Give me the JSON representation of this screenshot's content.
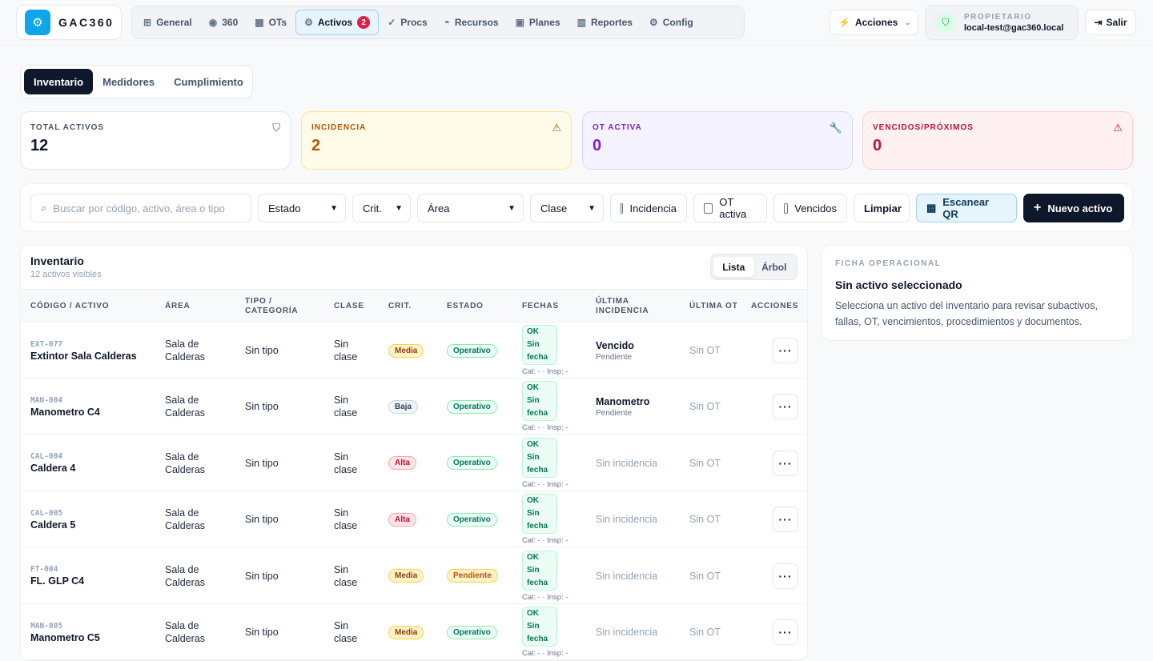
{
  "app": {
    "name": "GAC360"
  },
  "nav": [
    {
      "label": "General",
      "icon": "grid-icon",
      "glyph": "⊞"
    },
    {
      "label": "360",
      "icon": "eye-icon",
      "glyph": "◉"
    },
    {
      "label": "OTs",
      "icon": "table-icon",
      "glyph": "▦"
    },
    {
      "label": "Activos",
      "icon": "assets-icon",
      "glyph": "⚙",
      "badge": "2",
      "active": true
    },
    {
      "label": "Procs",
      "icon": "check-circle-icon",
      "glyph": "✓"
    },
    {
      "label": "Recursos",
      "icon": "helmet-icon",
      "glyph": "◓"
    },
    {
      "label": "Planes",
      "icon": "calendar-icon",
      "glyph": "▣"
    },
    {
      "label": "Reportes",
      "icon": "bar-chart-icon",
      "glyph": "▥"
    },
    {
      "label": "Config",
      "icon": "gear-icon",
      "glyph": "⚙"
    }
  ],
  "header": {
    "acciones_label": "Acciones",
    "user_role": "PROPIETARIO",
    "user_email": "local-test@gac360.local",
    "salir_label": "Salir"
  },
  "tabs": [
    {
      "label": "Inventario",
      "active": true
    },
    {
      "label": "Medidores"
    },
    {
      "label": "Cumplimiento"
    }
  ],
  "kpis": [
    {
      "label": "TOTAL ACTIVOS",
      "value": "12",
      "icon": "shield-icon",
      "glyph": "⛉",
      "color": "#475569",
      "bg": "#ffffff",
      "border": "#e3e7ee",
      "valueColor": "#0f172a"
    },
    {
      "label": "INCIDENCIA",
      "value": "2",
      "icon": "warning-icon",
      "glyph": "⚠",
      "color": "#b45309",
      "bg": "#fefce8",
      "border": "#fde68a",
      "valueColor": "#b45309"
    },
    {
      "label": "OT ACTIVA",
      "value": "0",
      "icon": "wrench-icon",
      "glyph": "🔧",
      "color": "#7e22ce",
      "bg": "#f5f3ff",
      "border": "#ddd6fe",
      "valueColor": "#7e22ce"
    },
    {
      "label": "VENCIDOS/PRÓXIMOS",
      "value": "0",
      "icon": "alert-triangle-icon",
      "glyph": "⚠",
      "color": "#be123c",
      "bg": "#fff1f2",
      "border": "#fecdd3",
      "valueColor": "#be123c"
    }
  ],
  "filters": {
    "search_placeholder": "Buscar por código, activo, área o tipo",
    "estado": "Estado",
    "crit": "Crit.",
    "area": "Área",
    "clase": "Clase",
    "incidencia": "Incidencia",
    "ot_activa": "OT activa",
    "vencidos": "Vencidos",
    "limpiar": "Limpiar",
    "escanear": "Escanear QR",
    "nuevo": "Nuevo activo"
  },
  "inventory": {
    "title": "Inventario",
    "subtitle": "12 activos visibles",
    "view_list": "Lista",
    "view_tree": "Árbol",
    "columns": [
      "CÓDIGO / ACTIVO",
      "ÁREA",
      "TIPO / CATEGORÍA",
      "CLASE",
      "CRIT.",
      "ESTADO",
      "FECHAS",
      "ÚLTIMA INCIDENCIA",
      "ÚLTIMA OT",
      "ACCIONES"
    ],
    "rows": [
      {
        "code": "EXT-077",
        "name": "Extintor Sala Calderas",
        "area1": "Sala de",
        "area2": "Calderas",
        "tipo": "Sin tipo",
        "clase1": "Sin",
        "clase2": "clase",
        "crit": "Media",
        "estado": "Operativo",
        "fecha1": "OK Sin",
        "fecha2": "fecha",
        "calinsp": "Cal: - · Insp: -",
        "inc": "Vencido",
        "inc_sub": "Pendiente",
        "ot": "Sin OT"
      },
      {
        "code": "MAN-004",
        "name": "Manometro C4",
        "area1": "Sala de",
        "area2": "Calderas",
        "tipo": "Sin tipo",
        "clase1": "Sin",
        "clase2": "clase",
        "crit": "Baja",
        "estado": "Operativo",
        "fecha1": "OK Sin",
        "fecha2": "fecha",
        "calinsp": "Cal: - · Insp: -",
        "inc": "Manometro",
        "inc_sub": "Pendiente",
        "ot": "Sin OT"
      },
      {
        "code": "CAL-004",
        "name": "Caldera 4",
        "area1": "Sala de",
        "area2": "Calderas",
        "tipo": "Sin tipo",
        "clase1": "Sin",
        "clase2": "clase",
        "crit": "Alta",
        "estado": "Operativo",
        "fecha1": "OK Sin",
        "fecha2": "fecha",
        "calinsp": "Cal: - · Insp: -",
        "inc": "Sin incidencia",
        "inc_sub": "",
        "ot": "Sin OT"
      },
      {
        "code": "CAL-005",
        "name": "Caldera 5",
        "area1": "Sala de",
        "area2": "Calderas",
        "tipo": "Sin tipo",
        "clase1": "Sin",
        "clase2": "clase",
        "crit": "Alta",
        "estado": "Operativo",
        "fecha1": "OK Sin",
        "fecha2": "fecha",
        "calinsp": "Cal: - · Insp: -",
        "inc": "Sin incidencia",
        "inc_sub": "",
        "ot": "Sin OT"
      },
      {
        "code": "FT-004",
        "name": "FL. GLP C4",
        "area1": "Sala de",
        "area2": "Calderas",
        "tipo": "Sin tipo",
        "clase1": "Sin",
        "clase2": "clase",
        "crit": "Media",
        "estado": "Pendiente",
        "fecha1": "OK Sin",
        "fecha2": "fecha",
        "calinsp": "Cal: - · Insp: -",
        "inc": "Sin incidencia",
        "inc_sub": "",
        "ot": "Sin OT"
      },
      {
        "code": "MAN-005",
        "name": "Manometro C5",
        "area1": "Sala de",
        "area2": "Calderas",
        "tipo": "Sin tipo",
        "clase1": "Sin",
        "clase2": "clase",
        "crit": "Media",
        "estado": "Operativo",
        "fecha1": "OK Sin",
        "fecha2": "fecha",
        "calinsp": "Cal: - · Insp: -",
        "inc": "Sin incidencia",
        "inc_sub": "",
        "ot": "Sin OT"
      }
    ]
  },
  "side": {
    "kicker": "FICHA OPERACIONAL",
    "title": "Sin activo seleccionado",
    "desc": "Selecciona un activo del inventario para revisar subactivos, fallas, OT, vencimientos, procedimientos y documentos."
  }
}
